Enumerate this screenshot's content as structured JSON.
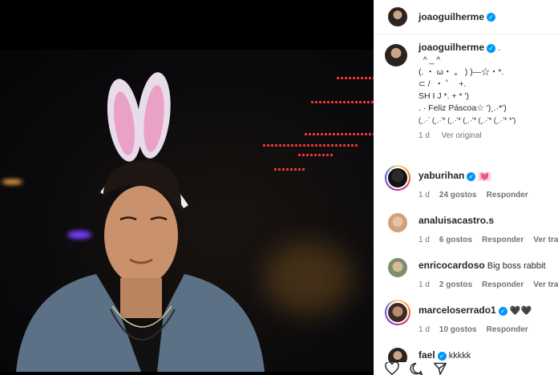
{
  "header": {
    "username": "joaoguilherme"
  },
  "caption": {
    "username": "joaoguilherme",
    "suffix": ".",
    "lines": [
      "  ^ _ ^",
      "(. ・ ω・ 。 ) )—☆・*.",
      "⊂ /  ・ ゜  +.",
      "SH I J *. + * ')",
      ". · Feliz Páscoa☆ ')¸.·*')",
      "(¸.·´ (¸.·'* (¸.·'* (¸.·'* (¸.·'* (¸.·'* *')"
    ],
    "time": "1 d",
    "translate": "Ver original"
  },
  "comments": [
    {
      "username": "yaburihan",
      "text": "💓",
      "time": "1 d",
      "likes": "24 gostos",
      "reply": "Responder",
      "verified": true,
      "ring": true
    },
    {
      "username": "analuisacastro.s",
      "text": "",
      "time": "1 d",
      "likes": "6 gostos",
      "reply": "Responder",
      "extra": "Ver trad",
      "verified": false,
      "ring": false
    },
    {
      "username": "enricocardoso",
      "text": "Big boss rabbit",
      "time": "1 d",
      "likes": "2 gostos",
      "reply": "Responder",
      "extra": "Ver trad",
      "verified": false,
      "ring": false
    },
    {
      "username": "marceloserrado1",
      "text": "🖤🖤",
      "time": "1 d",
      "likes": "10 gostos",
      "reply": "Responder",
      "verified": true,
      "ring": true
    },
    {
      "username": "fael",
      "text": "kkkkk",
      "verified": true
    }
  ],
  "icons": [
    "heart-icon",
    "comment-icon",
    "share-icon"
  ],
  "colors": {
    "verified": "#0095f6",
    "text": "#262626",
    "meta": "#737373"
  }
}
